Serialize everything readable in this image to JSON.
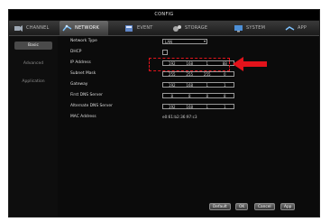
{
  "window": {
    "title": "CONFIG"
  },
  "tabs": [
    {
      "label": "CHANNEL",
      "icon": "camera-icon"
    },
    {
      "label": "NETWORK",
      "icon": "network-icon",
      "active": true
    },
    {
      "label": "EVENT",
      "icon": "event-icon"
    },
    {
      "label": "STORAGE",
      "icon": "storage-icon"
    },
    {
      "label": "SYSTEM",
      "icon": "system-icon"
    },
    {
      "label": "APP",
      "icon": "app-icon"
    }
  ],
  "sidebar": {
    "items": [
      {
        "label": "Basic",
        "active": true
      },
      {
        "label": "Advanced"
      },
      {
        "label": "Application"
      }
    ]
  },
  "form": {
    "network_type": {
      "label": "Network Type",
      "value": "LAN"
    },
    "dhcp": {
      "label": "DHCP",
      "checked": false
    },
    "ip_address": {
      "label": "IP Address",
      "octets": [
        "192",
        "168",
        "1",
        "88"
      ]
    },
    "subnet_mask": {
      "label": "Subnet Mask",
      "octets": [
        "255",
        "255",
        "255",
        "0"
      ]
    },
    "gateway": {
      "label": "Gateway",
      "octets": [
        "192",
        "168",
        "1",
        "1"
      ]
    },
    "first_dns": {
      "label": "First DNS Server",
      "octets": [
        "8",
        "8",
        "8",
        "8"
      ]
    },
    "alternate_dns": {
      "label": "Alternate DNS Server",
      "octets": [
        "192",
        "168",
        "1",
        "1"
      ]
    },
    "mac_address": {
      "label": "MAC Address",
      "value": "e0:61:b2:36:97:c3"
    }
  },
  "buttons": {
    "default": "Default",
    "ok": "OK",
    "cancel": "Cancel",
    "apply": "App"
  },
  "colors": {
    "highlight": "#e3131b",
    "background": "#0b0b0b",
    "active_tab": "#5a5a5a"
  }
}
